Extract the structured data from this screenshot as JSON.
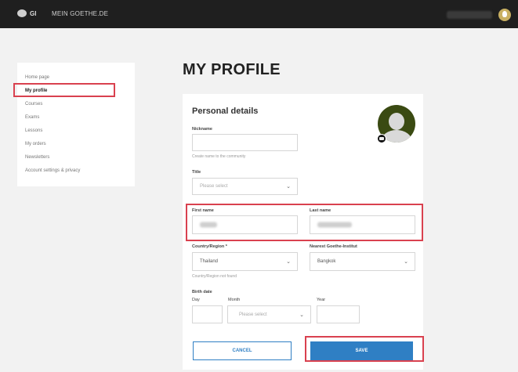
{
  "header": {
    "logo_text": "GI",
    "site_title": "MEIN GOETHE.DE"
  },
  "sidebar": {
    "items": [
      {
        "label": "Home page"
      },
      {
        "label": "My profile"
      },
      {
        "label": "Courses"
      },
      {
        "label": "Exams"
      },
      {
        "label": "Lessons"
      },
      {
        "label": "My orders"
      },
      {
        "label": "Newsletters"
      },
      {
        "label": "Account settings & privacy"
      }
    ]
  },
  "page_title": "MY PROFILE",
  "form": {
    "section_title": "Personal details",
    "nickname": {
      "label": "Nickname",
      "value": "",
      "hint": "Create name to the community"
    },
    "title": {
      "label": "Title",
      "placeholder": "Please select"
    },
    "first_name": {
      "label": "First name"
    },
    "last_name": {
      "label": "Last name"
    },
    "country": {
      "label": "Country/Region *",
      "value": "Thailand",
      "hint": "Country/Region not found"
    },
    "goethe_institut": {
      "label": "Nearest Goethe-Institut",
      "value": "Bangkok"
    },
    "birth_date": {
      "label": "Birth date",
      "day_label": "Day",
      "month_label": "Month",
      "month_placeholder": "Please select",
      "year_label": "Year"
    },
    "cancel_label": "CANCEL",
    "save_label": "SAVE"
  },
  "colors": {
    "topbar": "#1f1f1f",
    "accent": "#2f7fc4",
    "annotation": "#d9414f"
  }
}
